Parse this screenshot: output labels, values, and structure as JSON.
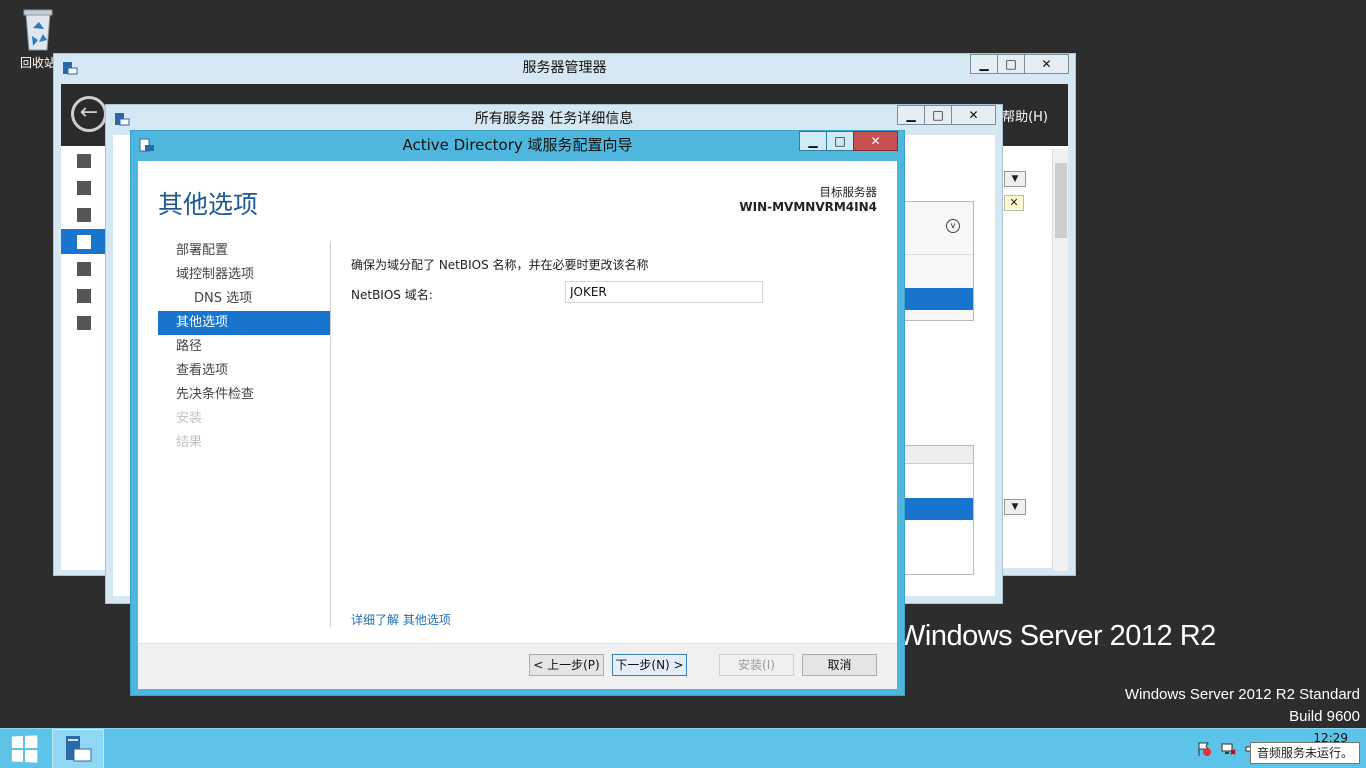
{
  "desktop": {
    "recycle_bin_label": "回收站",
    "watermark": "Windows Server 2012 R2",
    "edition_line1": "Windows Server 2012 R2 Standard",
    "edition_line2": "Build 9600"
  },
  "server_manager": {
    "title": "服务器管理器",
    "help_menu": "帮助(H)",
    "sidebar_icons": [
      "dashboard-icon",
      "local-server-icon",
      "all-servers-icon",
      "ad-ds-icon",
      "dns-icon",
      "file-services-icon",
      "storage-icon"
    ]
  },
  "task_details": {
    "title": "所有服务器 任务详细信息"
  },
  "wizard": {
    "title": "Active Directory 域服务配置向导",
    "heading": "其他选项",
    "target_label": "目标服务器",
    "target_name": "WIN-MVMNVRM4IN4",
    "nav": [
      {
        "label": "部署配置",
        "state": "normal"
      },
      {
        "label": "域控制器选项",
        "state": "normal"
      },
      {
        "label": "DNS 选项",
        "state": "sub"
      },
      {
        "label": "其他选项",
        "state": "active"
      },
      {
        "label": "路径",
        "state": "normal"
      },
      {
        "label": "查看选项",
        "state": "normal"
      },
      {
        "label": "先决条件检查",
        "state": "normal"
      },
      {
        "label": "安装",
        "state": "disabled"
      },
      {
        "label": "结果",
        "state": "disabled"
      }
    ],
    "description": "确保为域分配了 NetBIOS 名称，并在必要时更改该名称",
    "netbios_label": "NetBIOS 域名:",
    "netbios_value": "JOKER",
    "more_link": "详细了解 其他选项",
    "buttons": {
      "back": "< 上一步(P)",
      "next": "下一步(N) >",
      "install": "安装(I)",
      "cancel": "取消"
    }
  },
  "taskbar": {
    "clock": "12:29",
    "tooltip": "音频服务未运行。"
  },
  "colors": {
    "accent": "#1874cd",
    "taskbar": "#5ec3e8",
    "wizard_frame": "#4fb7de",
    "heading": "#1e5a96",
    "close_button": "#c75050"
  }
}
